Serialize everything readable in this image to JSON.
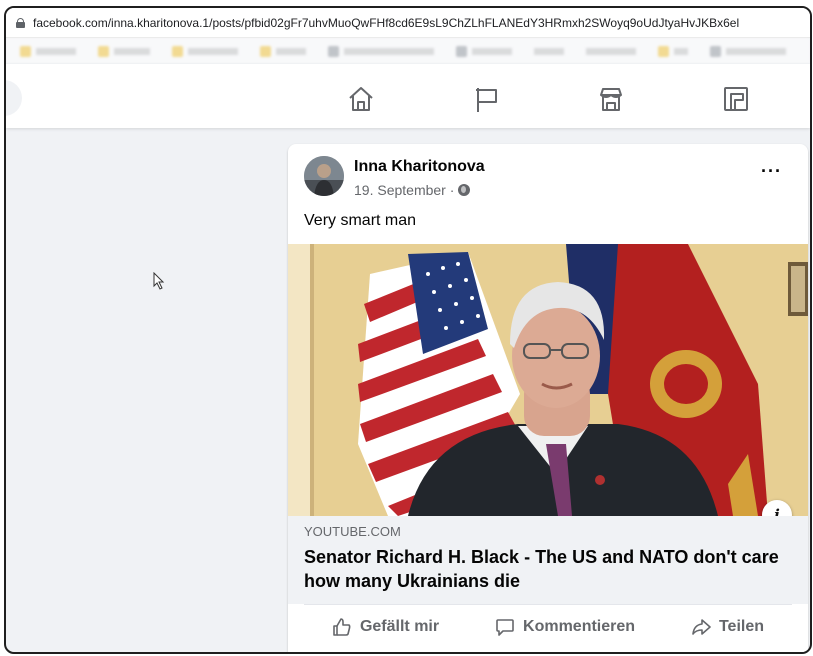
{
  "browser": {
    "url": "facebook.com/inna.kharitonova.1/posts/pfbid02gFr7uhvMuoQwFHf8cd6E9sL9ChZLhFLANEdY3HRmxh2SWoyq9oUdJtyaHvJKBx6el"
  },
  "fb_nav": {
    "icons": [
      "home-icon",
      "flag-pages-icon",
      "marketplace-icon",
      "gaming-icon"
    ]
  },
  "post": {
    "author": "Inna Kharitonova",
    "date": "19. September ·",
    "audience_icon": "globe-icon",
    "more_label": "···",
    "caption": "Very smart man",
    "link": {
      "domain": "YOUTUBE.COM",
      "title": "Senator Richard H. Black - The US and NATO don't care how many Ukrainians die"
    },
    "info_label": "i",
    "actions": [
      {
        "label": "Gefällt mir",
        "icon": "thumbs-up-icon"
      },
      {
        "label": "Kommentieren",
        "icon": "comment-icon"
      },
      {
        "label": "Teilen",
        "icon": "share-icon"
      }
    ]
  },
  "colors": {
    "facebook_bg": "#f0f2f5",
    "text_primary": "#050505",
    "text_secondary": "#65676b"
  }
}
